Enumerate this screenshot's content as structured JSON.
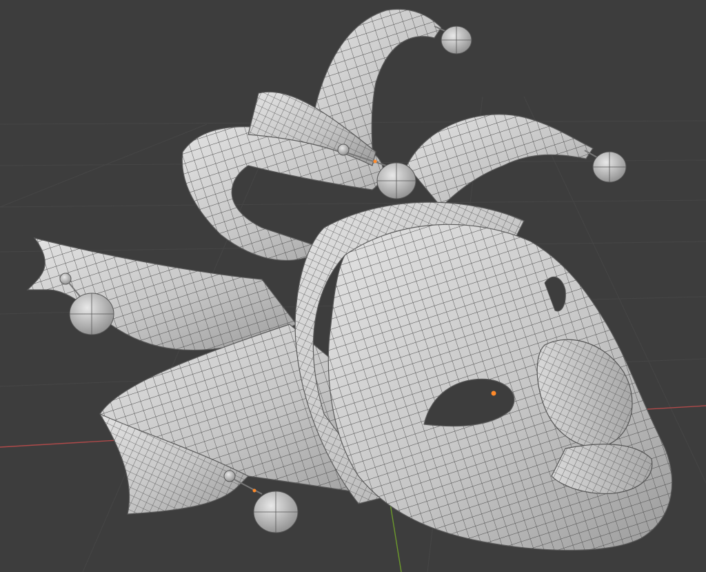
{
  "viewport": {
    "background": "#3d3d3d",
    "grid_color": "#464646",
    "x_axis_color": "#b04a4a",
    "y_axis_color": "#6d9a2c",
    "origin_color": "#ff8a2a",
    "mesh_color": "#c9c9c9",
    "wire_color": "#4a4a4a"
  },
  "scene": {
    "object": "jester-mask",
    "bells": 5,
    "view": "perspective"
  }
}
